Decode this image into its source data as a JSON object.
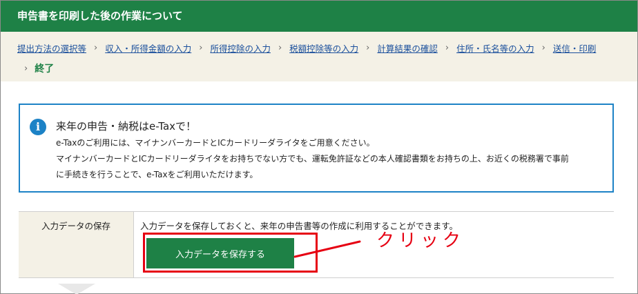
{
  "header": {
    "title": "申告書を印刷した後の作業について"
  },
  "breadcrumb": {
    "items": [
      "提出方法の選択等",
      "収入・所得金額の入力",
      "所得控除の入力",
      "税額控除等の入力",
      "計算結果の確認",
      "住所・氏名等の入力",
      "送信・印刷"
    ],
    "separator": "›",
    "current": "終了"
  },
  "info": {
    "icon": "info-icon",
    "icon_glyph": "i",
    "title": "来年の申告・納税はe-Taxで！",
    "lines": [
      "e-Taxのご利用には、マイナンバーカードとICカードリーダライタをご用意ください。",
      "マイナンバーカードとICカードリーダライタをお持ちでない方でも、運転免許証などの本人確認書類をお持ちの上、お近くの税務署で事前",
      "に手続きを行うことで、e-Taxをご利用いただけます。"
    ],
    "accent_color": "#1c82c6"
  },
  "save_section": {
    "label": "入力データの保存",
    "description": "入力データを保存しておくと、来年の申告書等の作成に利用することができます。",
    "button_label": "入力データを保存する"
  },
  "annotation": {
    "text": "クリック",
    "color": "#e60012"
  },
  "colors": {
    "brand_green": "#1e8146",
    "breadcrumb_bg": "#f4f1e6",
    "link": "#1a4f9c"
  }
}
